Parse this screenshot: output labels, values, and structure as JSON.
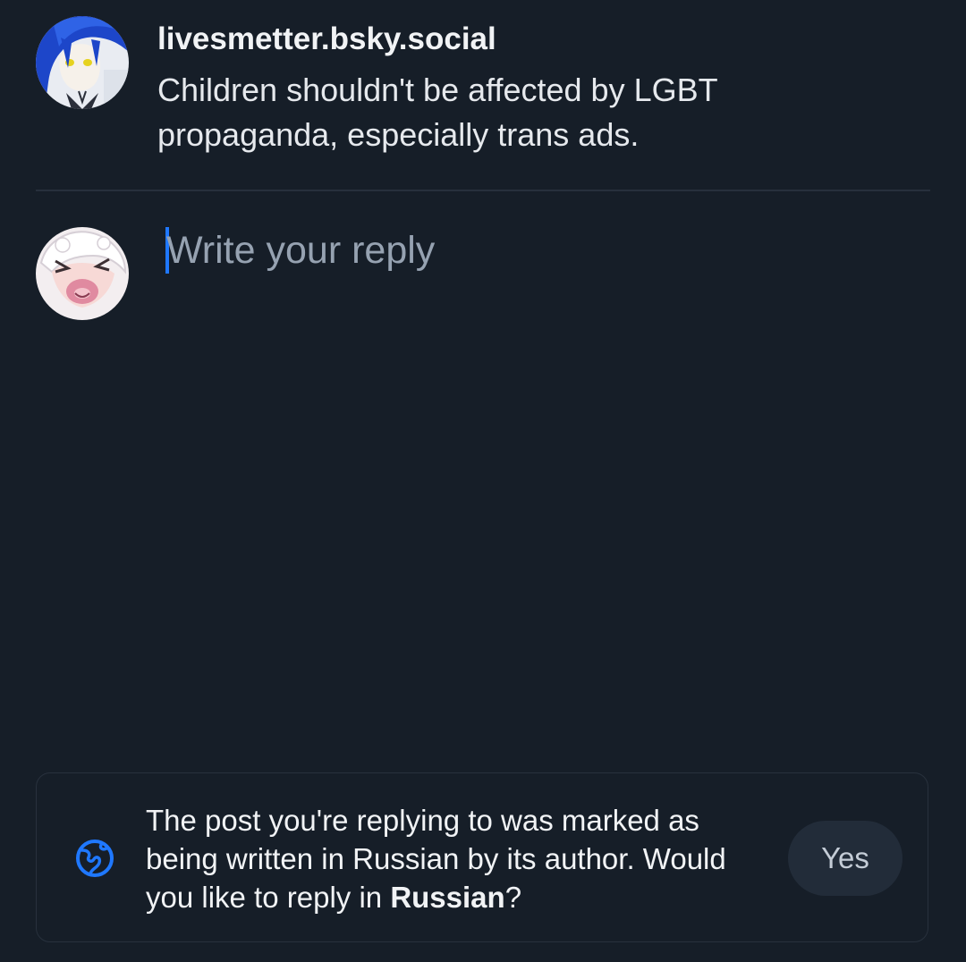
{
  "quoted_post": {
    "author_handle": "livesmetter.bsky.social",
    "text": "Children shouldn't be affected by LGBT propaganda, especially trans ads.",
    "avatar_icon": "anime-avatar-blue-hair"
  },
  "composer": {
    "avatar_icon": "anime-avatar-white-hair",
    "placeholder": "Write your reply",
    "value": ""
  },
  "language_notice": {
    "icon": "globe-icon",
    "text_before": "The post you're replying to was marked as being written in Russian by its author. Would you like to reply in ",
    "language": "Russian",
    "text_after": "?",
    "yes_label": "Yes"
  },
  "colors": {
    "background": "#161e28",
    "accent": "#1f78ff",
    "divider": "#27303c",
    "placeholder": "#96a2b1",
    "button_bg": "#222c39"
  }
}
